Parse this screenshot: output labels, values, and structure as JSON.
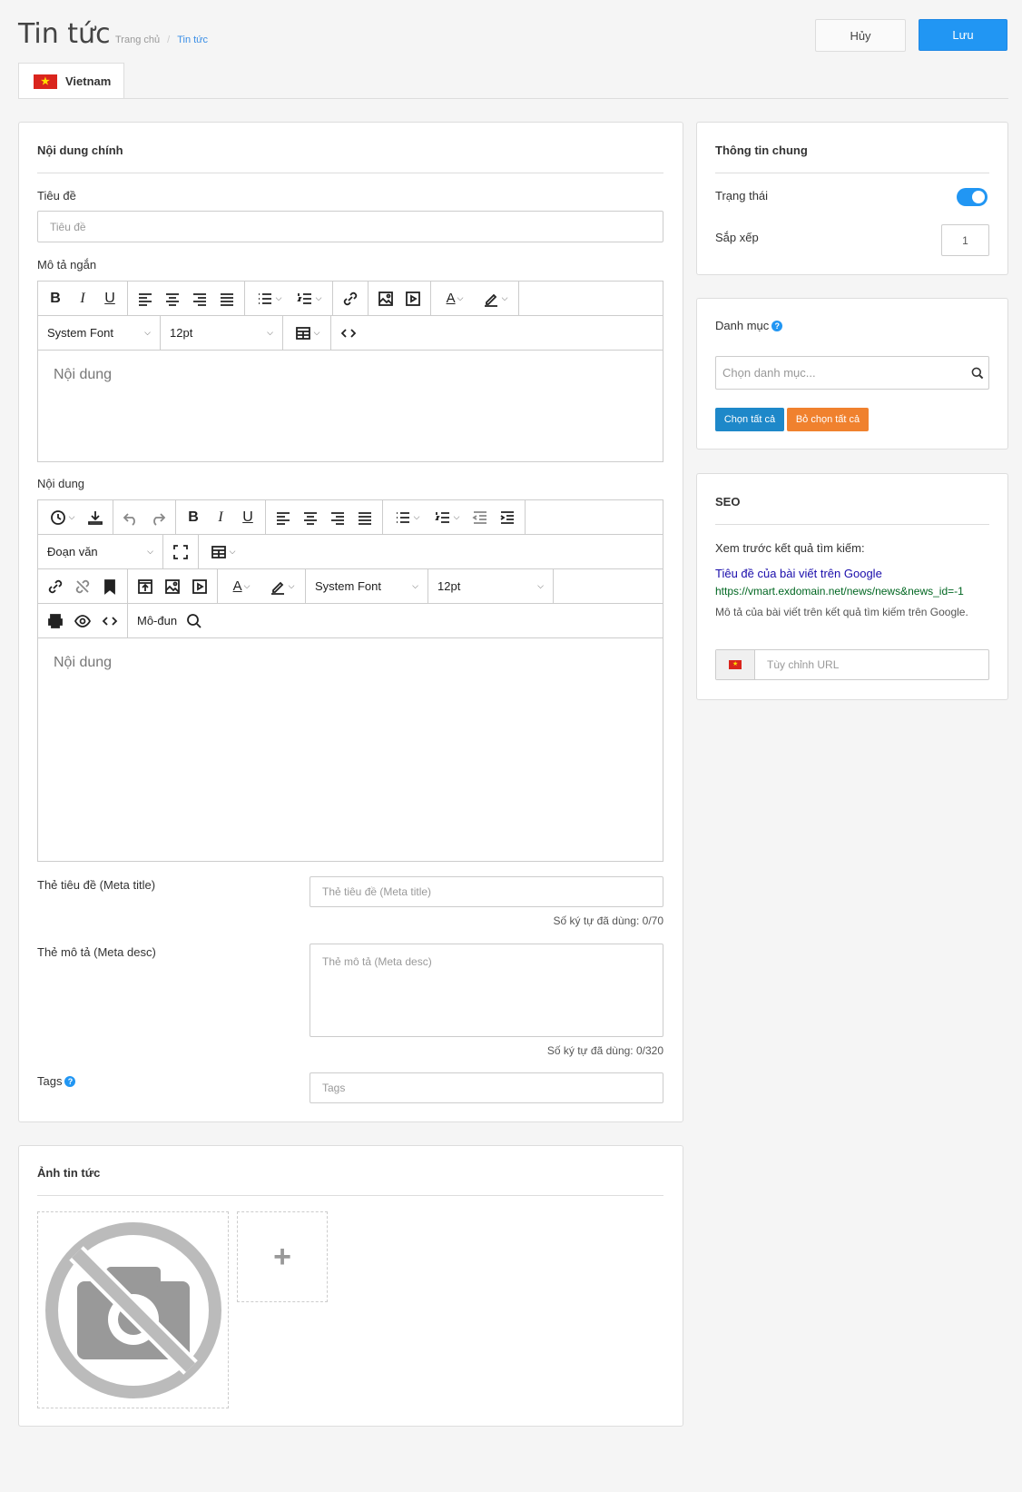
{
  "header": {
    "title": "Tin tức",
    "breadcrumb": {
      "home": "Trang chủ",
      "sep": "/",
      "current": "Tin tức"
    },
    "cancel_label": "Hủy",
    "save_label": "Lưu"
  },
  "lang_tab": {
    "label": "Vietnam"
  },
  "main": {
    "title": "Nội dung chính",
    "title_field": {
      "label": "Tiêu đề",
      "placeholder": "Tiêu đề"
    },
    "short_desc": {
      "label": "Mô tả ngắn",
      "font": "System Font",
      "size": "12pt",
      "placeholder": "Nội dung"
    },
    "content": {
      "label": "Nội dung",
      "block_format": "Đoạn văn",
      "font": "System Font",
      "size": "12pt",
      "module_label": "Mô-đun",
      "placeholder": "Nội dung"
    },
    "meta_title": {
      "label": "Thẻ tiêu đề (Meta title)",
      "placeholder": "Thẻ tiêu đề (Meta title)",
      "counter": "Số ký tự đã dùng: 0/70"
    },
    "meta_desc": {
      "label": "Thẻ mô tả (Meta desc)",
      "placeholder": "Thẻ mô tả (Meta desc)",
      "counter": "Số ký tự đã dùng: 0/320"
    },
    "tags": {
      "label": "Tags",
      "placeholder": "Tags",
      "help": "?"
    }
  },
  "images": {
    "title": "Ảnh tin tức",
    "add": "+"
  },
  "general": {
    "title": "Thông tin chung",
    "status_label": "Trạng thái",
    "status_on": true,
    "sort_label": "Sắp xếp",
    "sort_value": "1"
  },
  "category": {
    "title": "Danh mục",
    "help": "?",
    "placeholder": "Chọn danh mục...",
    "select_all": "Chọn tất cả",
    "deselect_all": "Bỏ chọn tất cả"
  },
  "seo": {
    "title": "SEO",
    "preview_label": "Xem trước kết quả tìm kiếm:",
    "preview_title": "Tiêu đề của bài viết trên Google",
    "preview_url": "https://vmart.exdomain.net/news/news&news_id=-1",
    "preview_desc": "Mô tả của bài viết trên kết quả tìm kiếm trên Google.",
    "url_placeholder": "Tùy chỉnh URL"
  },
  "colors": {
    "primary": "#2196f3",
    "select_all": "#1e88c9",
    "deselect_all": "#f0812e",
    "seo_title": "#1a0dab",
    "seo_url": "#006621"
  }
}
